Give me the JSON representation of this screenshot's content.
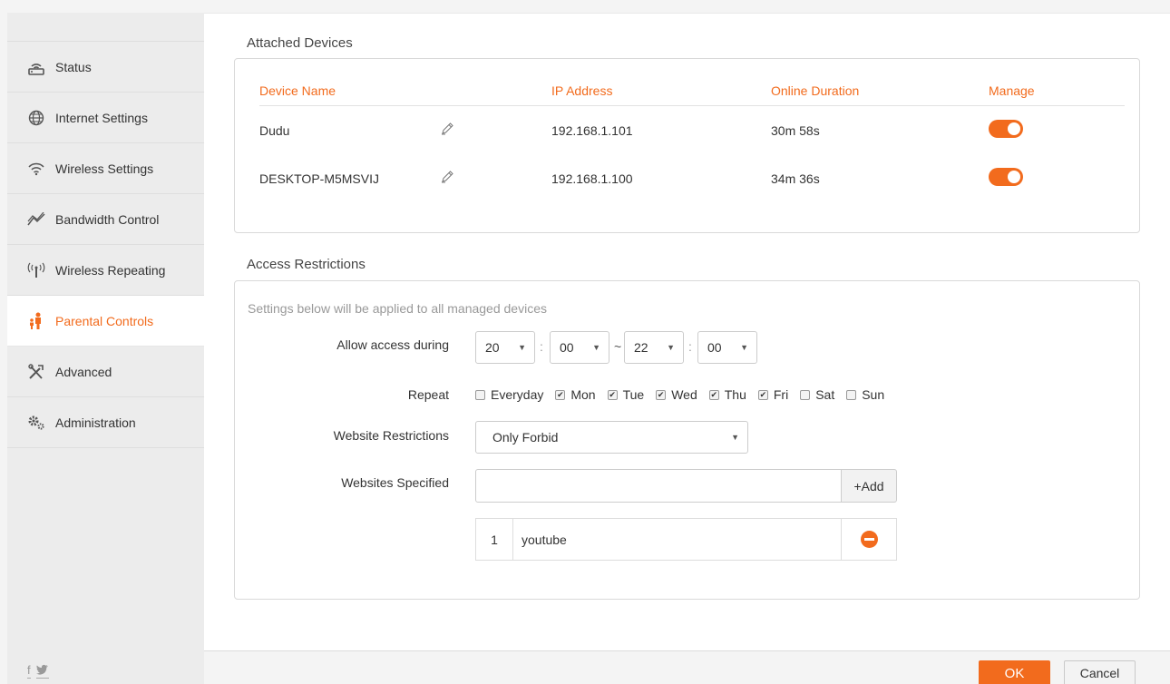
{
  "sidebar": {
    "items": [
      {
        "label": "Status",
        "icon": "router-icon"
      },
      {
        "label": "Internet Settings",
        "icon": "globe-icon"
      },
      {
        "label": "Wireless Settings",
        "icon": "wifi-icon"
      },
      {
        "label": "Bandwidth Control",
        "icon": "bandwidth-icon"
      },
      {
        "label": "Wireless Repeating",
        "icon": "antenna-icon"
      },
      {
        "label": "Parental Controls",
        "icon": "parent-child-icon",
        "active": true
      },
      {
        "label": "Advanced",
        "icon": "tools-icon"
      },
      {
        "label": "Administration",
        "icon": "gears-icon"
      }
    ],
    "social": [
      "f",
      "twitter-icon"
    ]
  },
  "attached": {
    "title": "Attached Devices",
    "columns": [
      "Device Name",
      "IP Address",
      "Online Duration",
      "Manage"
    ],
    "rows": [
      {
        "name": "Dudu",
        "ip": "192.168.1.101",
        "duration": "30m 58s",
        "manage": true
      },
      {
        "name": "DESKTOP-M5MSVIJ",
        "ip": "192.168.1.100",
        "duration": "34m 36s",
        "manage": true
      }
    ]
  },
  "access": {
    "title": "Access Restrictions",
    "hint": "Settings below will be applied to all managed devices",
    "allow_label": "Allow access during",
    "time": {
      "start_hour": "20",
      "start_min": "00",
      "end_hour": "22",
      "end_min": "00",
      "sep": ":",
      "tilde": "~"
    },
    "repeat_label": "Repeat",
    "days": [
      {
        "label": "Everyday",
        "checked": false
      },
      {
        "label": "Mon",
        "checked": true
      },
      {
        "label": "Tue",
        "checked": true
      },
      {
        "label": "Wed",
        "checked": true
      },
      {
        "label": "Thu",
        "checked": true
      },
      {
        "label": "Fri",
        "checked": true
      },
      {
        "label": "Sat",
        "checked": false
      },
      {
        "label": "Sun",
        "checked": false
      }
    ],
    "website_restrictions_label": "Website Restrictions",
    "website_restrictions_value": "Only Forbid",
    "websites_label": "Websites Specified",
    "website_input_value": "",
    "add_label": "+Add",
    "sites": [
      {
        "num": "1",
        "name": "youtube"
      }
    ]
  },
  "footer": {
    "ok": "OK",
    "cancel": "Cancel"
  },
  "colors": {
    "accent": "#f26b1d"
  }
}
